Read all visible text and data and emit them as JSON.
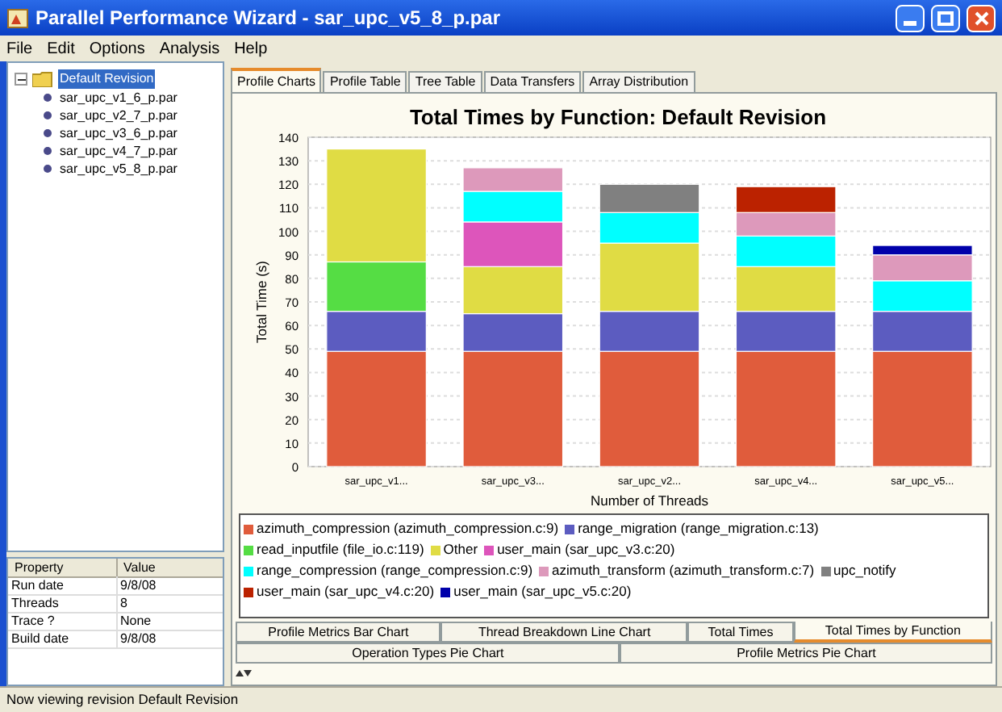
{
  "window": {
    "title": "Parallel Performance Wizard - sar_upc_v5_8_p.par"
  },
  "menu": [
    "File",
    "Edit",
    "Options",
    "Analysis",
    "Help"
  ],
  "tree": {
    "label": "Default Revision",
    "selected": true,
    "expanded": true,
    "children": [
      {
        "label": "sar_upc_v1_6_p.par",
        "selected": false
      },
      {
        "label": "sar_upc_v2_7_p.par",
        "selected": false
      },
      {
        "label": "sar_upc_v3_6_p.par",
        "selected": false
      },
      {
        "label": "sar_upc_v4_7_p.par",
        "selected": false
      },
      {
        "label": "sar_upc_v5_8_p.par",
        "selected": false
      }
    ]
  },
  "properties": {
    "columns": [
      "Property",
      "Value"
    ],
    "rows": [
      [
        "Run date",
        "9/8/08"
      ],
      [
        "Threads",
        "8"
      ],
      [
        "Trace ?",
        "None"
      ],
      [
        "Build date",
        "9/8/08"
      ]
    ]
  },
  "tabs": [
    {
      "label": "Profile Charts",
      "selected": true
    },
    {
      "label": "Profile Table",
      "selected": false
    },
    {
      "label": "Tree Table",
      "selected": false
    },
    {
      "label": "Data Transfers",
      "selected": false
    },
    {
      "label": "Array Distribution",
      "selected": false
    }
  ],
  "chart_data": {
    "type": "bar",
    "stacked": true,
    "grid": true,
    "title": "Total Times by Function: Default Revision",
    "xlabel": "Number of Threads",
    "ylabel": "Total Time (s)",
    "categories": [
      "sar_upc_v1...",
      "sar_upc_v3...",
      "sar_upc_v2...",
      "sar_upc_v4...",
      "sar_upc_v5..."
    ],
    "ylim": [
      0,
      140
    ],
    "yticks": [
      0,
      10,
      20,
      30,
      40,
      50,
      60,
      70,
      80,
      90,
      100,
      110,
      120,
      130,
      140
    ],
    "series": [
      {
        "name": "azimuth_compression (azimuth_compression.c:9)",
        "color": "#e05c3c",
        "values": [
          49,
          49,
          49,
          49,
          49
        ]
      },
      {
        "name": "range_migration (range_migration.c:13)",
        "color": "#5c5cc0",
        "values": [
          17,
          16,
          17,
          17,
          17
        ]
      },
      {
        "name": "read_inputfile (file_io.c:119)",
        "color": "#55dd44",
        "values": [
          21,
          null,
          null,
          null,
          null
        ]
      },
      {
        "name": "Other",
        "color": "#e0dc44",
        "values": [
          48,
          20,
          29,
          19,
          null
        ]
      },
      {
        "name": "user_main (sar_upc_v3.c:20)",
        "color": "#dd55bb",
        "values": [
          null,
          19,
          null,
          null,
          null
        ]
      },
      {
        "name": "range_compression (range_compression.c:9)",
        "color": "#00ffff",
        "values": [
          null,
          13,
          13,
          13,
          13
        ]
      },
      {
        "name": "azimuth_transform (azimuth_transform.c:7)",
        "color": "#dd99bb",
        "values": [
          null,
          10,
          null,
          10,
          11
        ]
      },
      {
        "name": "upc_notify",
        "color": "#808080",
        "values": [
          null,
          null,
          12,
          null,
          null
        ]
      },
      {
        "name": "user_main (sar_upc_v4.c:20)",
        "color": "#bb2200",
        "values": [
          null,
          null,
          null,
          11,
          null
        ]
      },
      {
        "name": "user_main (sar_upc_v5.c:20)",
        "color": "#0000aa",
        "values": [
          null,
          null,
          null,
          null,
          4
        ]
      }
    ]
  },
  "chart_tabs": [
    [
      {
        "label": "Profile Metrics Bar Chart",
        "selected": false
      },
      {
        "label": "Thread Breakdown Line Chart",
        "selected": false
      },
      {
        "label": "Total Times",
        "selected": false
      },
      {
        "label": "Total Times by Function",
        "selected": true
      }
    ],
    [
      {
        "label": "Operation Types Pie Chart",
        "selected": false
      },
      {
        "label": "Profile Metrics Pie Chart",
        "selected": false
      }
    ]
  ],
  "status_bar": "Now viewing revision Default Revision"
}
